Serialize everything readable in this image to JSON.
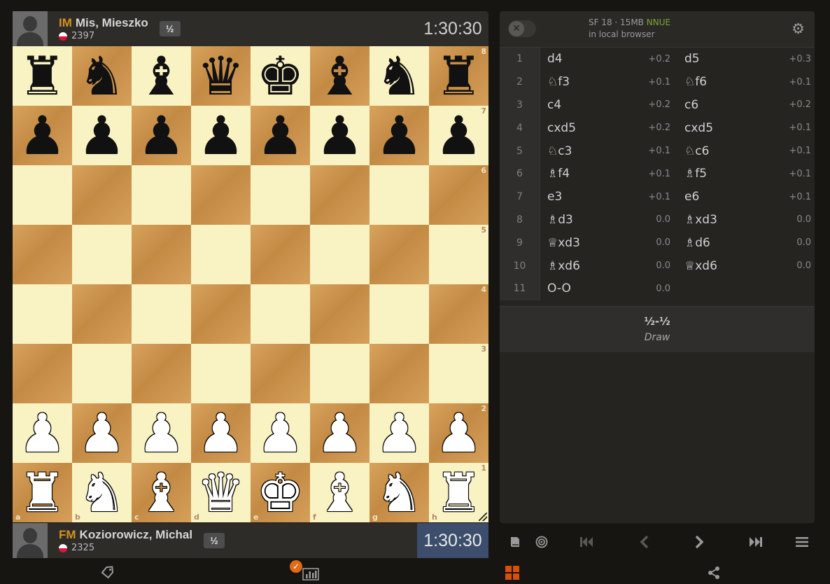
{
  "top_player": {
    "title": "IM",
    "name": "Mis, Mieszko",
    "rating": "2397",
    "score": "½",
    "clock": "1:30:30"
  },
  "bottom_player": {
    "title": "FM",
    "name": "Koziorowicz, Michal",
    "rating": "2325",
    "score": "½",
    "clock": "1:30:30"
  },
  "board": {
    "ranks": [
      "8",
      "7",
      "6",
      "5",
      "4",
      "3",
      "2",
      "1"
    ],
    "files": [
      "a",
      "b",
      "c",
      "d",
      "e",
      "f",
      "g",
      "h"
    ],
    "position": [
      [
        "r",
        "n",
        "b",
        "q",
        "k",
        "b",
        "n",
        "r"
      ],
      [
        "p",
        "p",
        "p",
        "p",
        "p",
        "p",
        "p",
        "p"
      ],
      [
        "",
        "",
        "",
        "",
        "",
        "",
        "",
        ""
      ],
      [
        "",
        "",
        "",
        "",
        "",
        "",
        "",
        ""
      ],
      [
        "",
        "",
        "",
        "",
        "",
        "",
        "",
        ""
      ],
      [
        "",
        "",
        "",
        "",
        "",
        "",
        "",
        ""
      ],
      [
        "P",
        "P",
        "P",
        "P",
        "P",
        "P",
        "P",
        "P"
      ],
      [
        "R",
        "N",
        "B",
        "Q",
        "K",
        "B",
        "N",
        "R"
      ]
    ]
  },
  "engine": {
    "name": "SF 18 · 15MB",
    "nnue": "NNUE",
    "location": "in local browser",
    "toggle_icon": "close-icon",
    "settings_icon": "gear-icon"
  },
  "moves": [
    {
      "num": "1",
      "white": "d4",
      "white_eval": "+0.2",
      "black": "d5",
      "black_eval": "+0.3"
    },
    {
      "num": "2",
      "white": "♘f3",
      "white_eval": "+0.1",
      "black": "♘f6",
      "black_eval": "+0.1"
    },
    {
      "num": "3",
      "white": "c4",
      "white_eval": "+0.2",
      "black": "c6",
      "black_eval": "+0.2"
    },
    {
      "num": "4",
      "white": "cxd5",
      "white_eval": "+0.2",
      "black": "cxd5",
      "black_eval": "+0.1"
    },
    {
      "num": "5",
      "white": "♘c3",
      "white_eval": "+0.1",
      "black": "♘c6",
      "black_eval": "+0.1"
    },
    {
      "num": "6",
      "white": "♗f4",
      "white_eval": "+0.1",
      "black": "♗f5",
      "black_eval": "+0.1"
    },
    {
      "num": "7",
      "white": "e3",
      "white_eval": "+0.1",
      "black": "e6",
      "black_eval": "+0.1"
    },
    {
      "num": "8",
      "white": "♗d3",
      "white_eval": "0.0",
      "black": "♗xd3",
      "black_eval": "0.0"
    },
    {
      "num": "9",
      "white": "♕xd3",
      "white_eval": "0.0",
      "black": "♗d6",
      "black_eval": "0.0"
    },
    {
      "num": "10",
      "white": "♗xd6",
      "white_eval": "0.0",
      "black": "♕xd6",
      "black_eval": "0.0"
    },
    {
      "num": "11",
      "white": "O-O",
      "white_eval": "0.0",
      "black": "",
      "black_eval": ""
    }
  ],
  "result": {
    "score": "½-½",
    "text": "Draw"
  },
  "controls": {
    "opening_book_icon": "book-icon",
    "practice_icon": "target-icon",
    "first_icon": "first-move-icon",
    "prev_icon": "prev-move-icon",
    "next_icon": "next-move-icon",
    "last_icon": "last-move-icon",
    "menu_icon": "hamburger-menu-icon"
  },
  "bottom_tools": {
    "tag_icon": "tag-icon",
    "computer_analysis_icon": "bar-chart-icon",
    "explorer_icon": "grid-icon",
    "share_icon": "share-icon"
  },
  "colors": {
    "accent": "#d85000",
    "active_clock": "#3c4e6b",
    "title": "#d59120",
    "nnue": "#7ca53b"
  }
}
